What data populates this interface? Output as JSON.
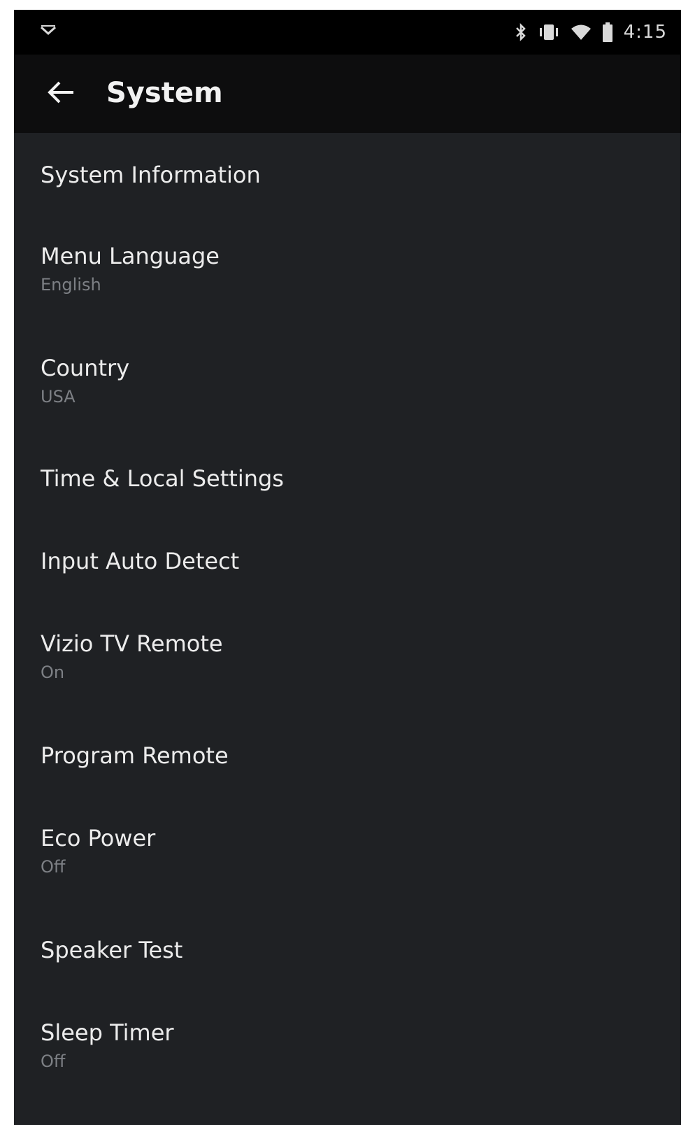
{
  "status_bar": {
    "time": "4:15",
    "icons": [
      "notification-chevron-icon",
      "bluetooth-icon",
      "vibrate-icon",
      "wifi-icon",
      "battery-icon"
    ]
  },
  "app_bar": {
    "back_icon": "arrow-left-icon",
    "title": "System"
  },
  "menu": {
    "items": [
      {
        "title": "System Information"
      },
      {
        "title": "Menu Language",
        "value": "English"
      },
      {
        "title": "Country",
        "value": "USA"
      },
      {
        "title": "Time & Local Settings"
      },
      {
        "title": "Input Auto Detect"
      },
      {
        "title": "Vizio TV Remote",
        "value": "On"
      },
      {
        "title": "Program Remote"
      },
      {
        "title": "Eco Power",
        "value": "Off"
      },
      {
        "title": "Speaker Test"
      },
      {
        "title": "Sleep Timer",
        "value": "Off"
      }
    ]
  },
  "colors": {
    "background": "#1f2124",
    "status_bar": "#000000",
    "app_bar": "#0d0d0e",
    "primary_text": "#ececec",
    "secondary_text": "#7d8085"
  }
}
